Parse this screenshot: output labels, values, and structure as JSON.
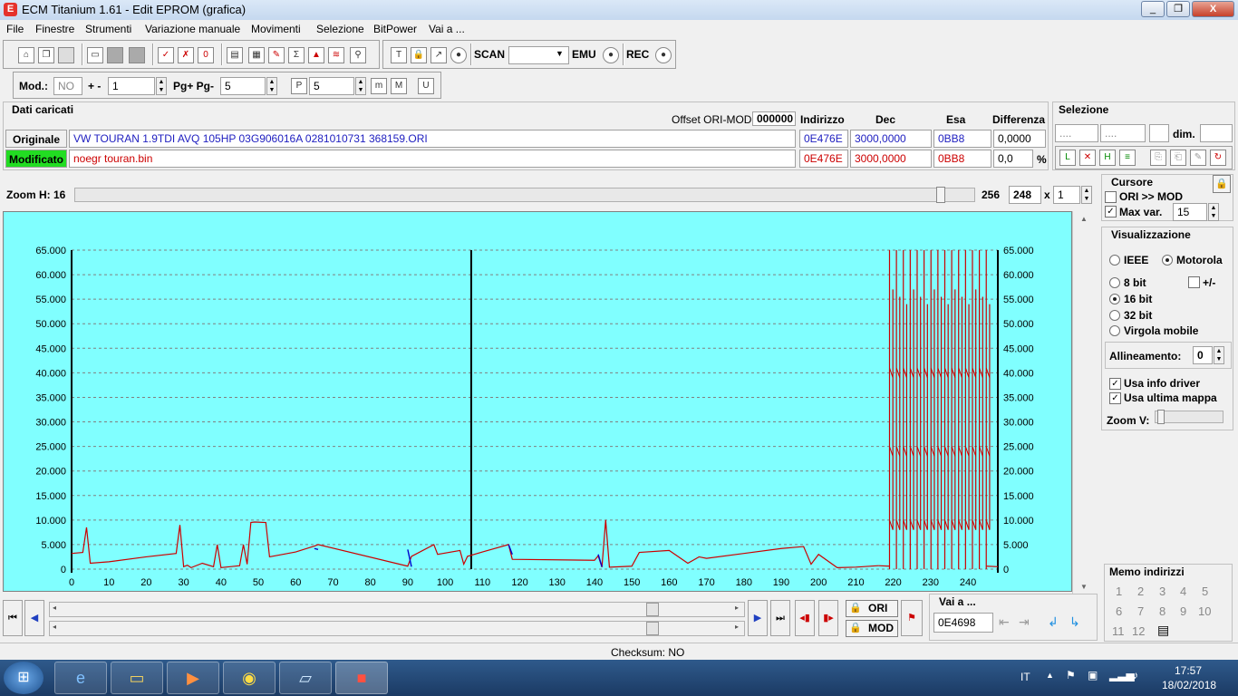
{
  "window": {
    "title": "ECM Titanium 1.61 - Edit EPROM (grafica)",
    "app_icon_glyph": "E",
    "btn_min": "_",
    "btn_max": "❐",
    "btn_close": "X"
  },
  "menu": [
    "File",
    "Finestre",
    "Strumenti",
    "Variazione manuale",
    "Movimenti",
    "Selezione",
    "BitPower",
    "Vai a ..."
  ],
  "toolbar": {
    "scan_label": "SCAN",
    "emu_label": "EMU",
    "rec_label": "REC",
    "mod_label": "Mod.:",
    "mod_value": "NO",
    "plusminus_label": "+ -",
    "plusminus_value": "1",
    "pg_label": "Pg+ Pg-",
    "pg_value": "5",
    "p_value": "5"
  },
  "data_panel": {
    "title": "Dati caricati",
    "offset_label": "Offset ORI-MOD",
    "offset_value": "000000",
    "col_indirizzo": "Indirizzo",
    "col_dec": "Dec",
    "col_esa": "Esa",
    "col_diff": "Differenza",
    "originale_label": "Originale",
    "originale_file": "VW TOURAN 1.9TDI AVQ 105HP 03G906016A 0281010731 368159.ORI",
    "originale_addr": "0E476E",
    "originale_dec": "3000,0000",
    "originale_esa": "0BB8",
    "originale_diff": "0,0000",
    "modificato_label": "Modificato",
    "modificato_file": "noegr touran.bin",
    "modificato_addr": "0E476E",
    "modificato_dec": "3000,0000",
    "modificato_esa": "0BB8",
    "modificato_diff": "0,0",
    "percent": "%"
  },
  "selezione": {
    "title": "Selezione",
    "f1": "....",
    "f2": "....",
    "dim_label": "dim."
  },
  "zoom": {
    "label": "Zoom H: 16",
    "val1": "256",
    "val2": "248",
    "x": "x",
    "val3": "1"
  },
  "cursore": {
    "title": "Cursore",
    "ori_mod": "ORI >> MOD",
    "max_var": "Max var.",
    "max_var_value": "15"
  },
  "visual": {
    "title": "Visualizzazione",
    "ieee": "IEEE",
    "motorola": "Motorola",
    "b8": "8 bit",
    "pm": "+/-",
    "b16": "16 bit",
    "b32": "32 bit",
    "virgola": "Virgola mobile",
    "allineamento": "Allineamento:",
    "allineamento_value": "0",
    "usa_info": "Usa info driver",
    "usa_ultima": "Usa ultima mappa",
    "zoom_v": "Zoom V:"
  },
  "memo": {
    "title": "Memo indirizzi",
    "numbers": [
      "1",
      "2",
      "3",
      "4",
      "5",
      "6",
      "7",
      "8",
      "9",
      "10",
      "11",
      "12"
    ]
  },
  "bottom": {
    "ori_btn": "ORI",
    "mod_btn": "MOD",
    "vai_label": "Vai a ...",
    "vai_value": "0E4698",
    "checksum": "Checksum: NO"
  },
  "taskbar": {
    "lang": "IT",
    "time": "17:57",
    "date": "18/02/2018"
  },
  "colors": {
    "plot_bg": "#80ffff",
    "ori_line": "#0000cc",
    "mod_line": "#cc0000",
    "modificato_bg": "#22dd22"
  },
  "chart_data": {
    "type": "line",
    "ylim": [
      0,
      65000
    ],
    "xlim": [
      0,
      248
    ],
    "yticks": [
      "0",
      "5.000",
      "10.000",
      "15.000",
      "20.000",
      "25.000",
      "30.000",
      "35.000",
      "40.000",
      "45.000",
      "50.000",
      "55.000",
      "60.000",
      "65.000"
    ],
    "xticks": [
      0,
      10,
      20,
      30,
      40,
      50,
      60,
      70,
      80,
      90,
      100,
      110,
      120,
      130,
      140,
      150,
      160,
      170,
      180,
      190,
      200,
      210,
      220,
      230,
      240
    ],
    "grid": true,
    "cursor_x": 107,
    "series": [
      {
        "x": [
          0,
          3,
          4,
          5,
          10,
          20,
          28,
          29,
          30,
          31,
          32,
          35,
          38,
          39,
          40,
          45,
          46,
          47,
          48,
          49,
          52,
          53,
          60,
          65,
          66,
          90,
          91,
          97,
          98,
          104,
          105,
          106,
          110,
          117,
          118,
          140,
          141,
          142,
          143,
          144,
          150,
          152,
          160,
          165,
          168,
          170,
          180,
          190,
          196,
          198,
          200,
          205,
          210,
          216
        ],
        "y": [
          3200,
          3400,
          8500,
          1200,
          1500,
          2500,
          3200,
          9000,
          500,
          800,
          300,
          1200,
          500,
          5000,
          300,
          700,
          5000,
          1000,
          9500,
          9600,
          9500,
          2500,
          3500,
          4700,
          5000,
          600,
          2600,
          5000,
          3000,
          3800,
          1000,
          2600,
          3500,
          5000,
          2000,
          1800,
          2700,
          400,
          10000,
          400,
          600,
          3400,
          3800,
          1200,
          2500,
          2200,
          3200,
          4200,
          4600,
          1000,
          3000,
          300,
          400,
          700
        ]
      },
      {
        "x": [
          65,
          66,
          90,
          91,
          117,
          118,
          141,
          142
        ],
        "y": [
          4200,
          4000,
          4000,
          500,
          5000,
          3000,
          3000,
          500
        ]
      }
    ]
  }
}
